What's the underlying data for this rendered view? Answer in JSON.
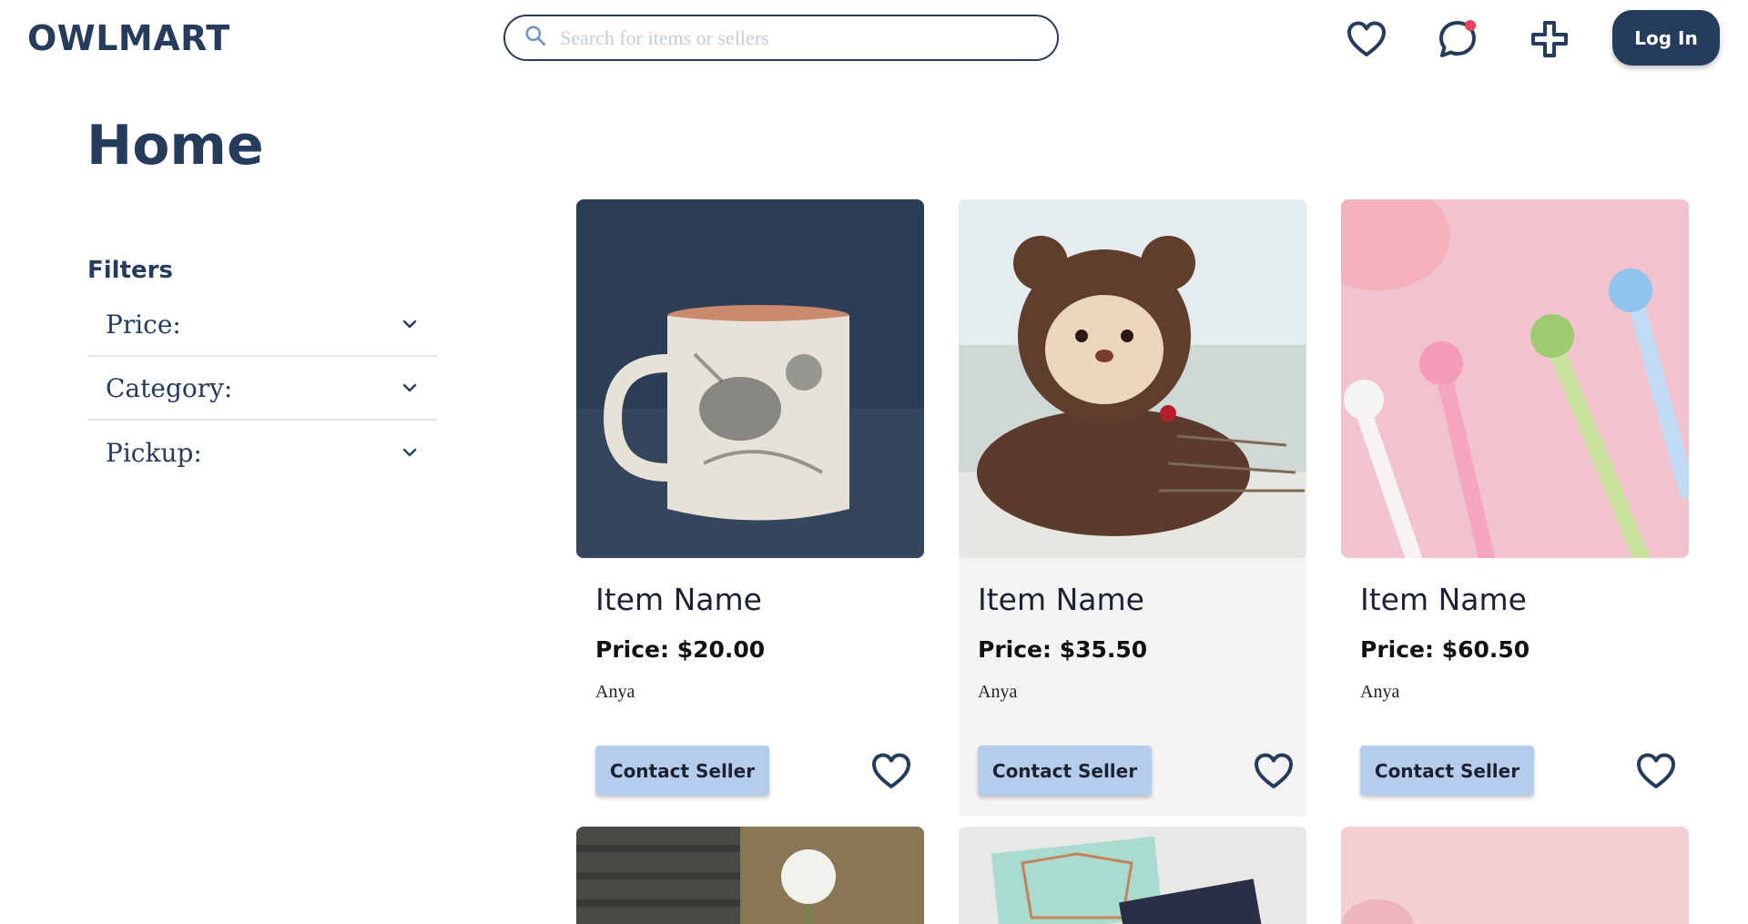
{
  "header": {
    "logo": "OWLMART",
    "search_placeholder": "Search for items or sellers",
    "login_label": "Log In",
    "icons": [
      "heart-icon",
      "chat-icon",
      "plus-icon",
      "search-icon"
    ]
  },
  "page": {
    "title": "Home"
  },
  "filters": {
    "title": "Filters",
    "items": [
      {
        "label": "Price:"
      },
      {
        "label": "Category:"
      },
      {
        "label": "Pickup:"
      }
    ]
  },
  "products": [
    {
      "name": "Item Name",
      "price": "Price: $20.00",
      "seller": "Anya",
      "contact_label": "Contact Seller",
      "image": "mug"
    },
    {
      "name": "Item Name",
      "price": "Price: $35.50",
      "seller": "Anya",
      "contact_label": "Contact Seller",
      "image": "teddy-bear"
    },
    {
      "name": "Item Name",
      "price": "Price: $60.50",
      "seller": "Anya",
      "contact_label": "Contact Seller",
      "image": "pens"
    }
  ],
  "more_products_images": [
    "rose",
    "notes-card",
    "pink-item"
  ],
  "colors": {
    "primary": "#263c5c",
    "button_light": "#b5cdea",
    "notification_dot": "#e8445a",
    "card_highlight": "#f4f4f4"
  }
}
